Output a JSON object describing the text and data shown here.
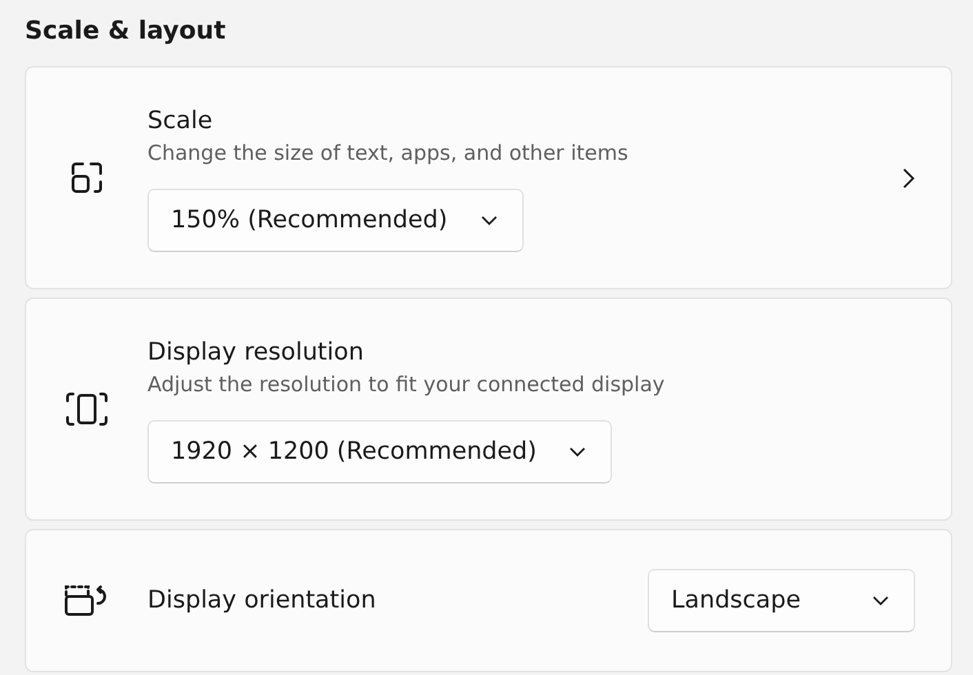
{
  "heading": "Scale & layout",
  "settings": [
    {
      "kind": "scale",
      "title": "Scale",
      "description": "Change the size of text, apps, and other items",
      "dropdown": "150% (Recommended)"
    },
    {
      "kind": "resolution",
      "title": "Display resolution",
      "description": "Adjust the resolution to fit your connected display",
      "dropdown": "1920 × 1200 (Recommended)"
    },
    {
      "kind": "orientation",
      "title": "Display orientation",
      "dropdown": "Landscape"
    }
  ]
}
